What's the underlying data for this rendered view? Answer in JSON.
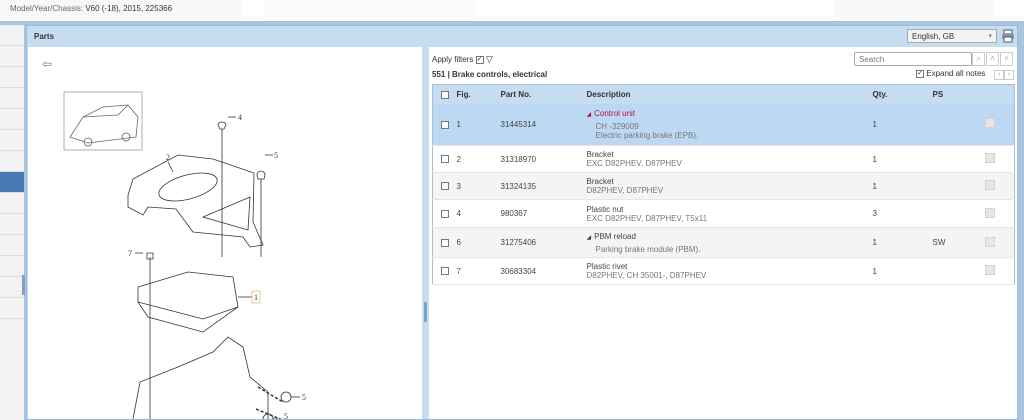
{
  "header": {
    "model_label": "Model/Year/Chassis:",
    "model_value": "V60 (-18), 2015, 225366"
  },
  "panel": {
    "title": "Parts",
    "language": "English, GB"
  },
  "toolbar": {
    "apply_filters": "Apply filters",
    "search_placeholder": "Search",
    "expand_all_notes": "Expand all notes",
    "section": "551  |  Brake controls, electrical"
  },
  "table": {
    "headers": [
      "Fig.",
      "Part No.",
      "Description",
      "Qty.",
      "PS"
    ],
    "rows": [
      {
        "fig": "1",
        "part": "31445314",
        "title": "Control unit",
        "lines": [
          "CH -329009",
          "Electric parking brake (EPB)."
        ],
        "qty": "1",
        "ps": ""
      },
      {
        "fig": "2",
        "part": "31318970",
        "title": "Bracket",
        "lines": [
          "EXC D82PHEV, D87PHEV"
        ],
        "qty": "1",
        "ps": ""
      },
      {
        "fig": "3",
        "part": "31324135",
        "title": "Bracket",
        "lines": [
          "D82PHEV, D87PHEV"
        ],
        "qty": "1",
        "ps": ""
      },
      {
        "fig": "4",
        "part": "980367",
        "title": "Plastic nut",
        "lines": [
          "EXC D82PHEV, D87PHEV, T5x11"
        ],
        "qty": "3",
        "ps": ""
      },
      {
        "fig": "6",
        "part": "31275406",
        "title": "PBM reload",
        "lines": [
          "Parking brake module (PBM)."
        ],
        "qty": "1",
        "ps": "SW"
      },
      {
        "fig": "7",
        "part": "30683304",
        "title": "Plastic rivet",
        "lines": [
          "D82PHEV, CH 35001-, D87PHEV"
        ],
        "qty": "1",
        "ps": ""
      }
    ]
  },
  "diagram": {
    "callouts": [
      "1",
      "2",
      "4",
      "5",
      "5",
      "5",
      "7"
    ]
  }
}
